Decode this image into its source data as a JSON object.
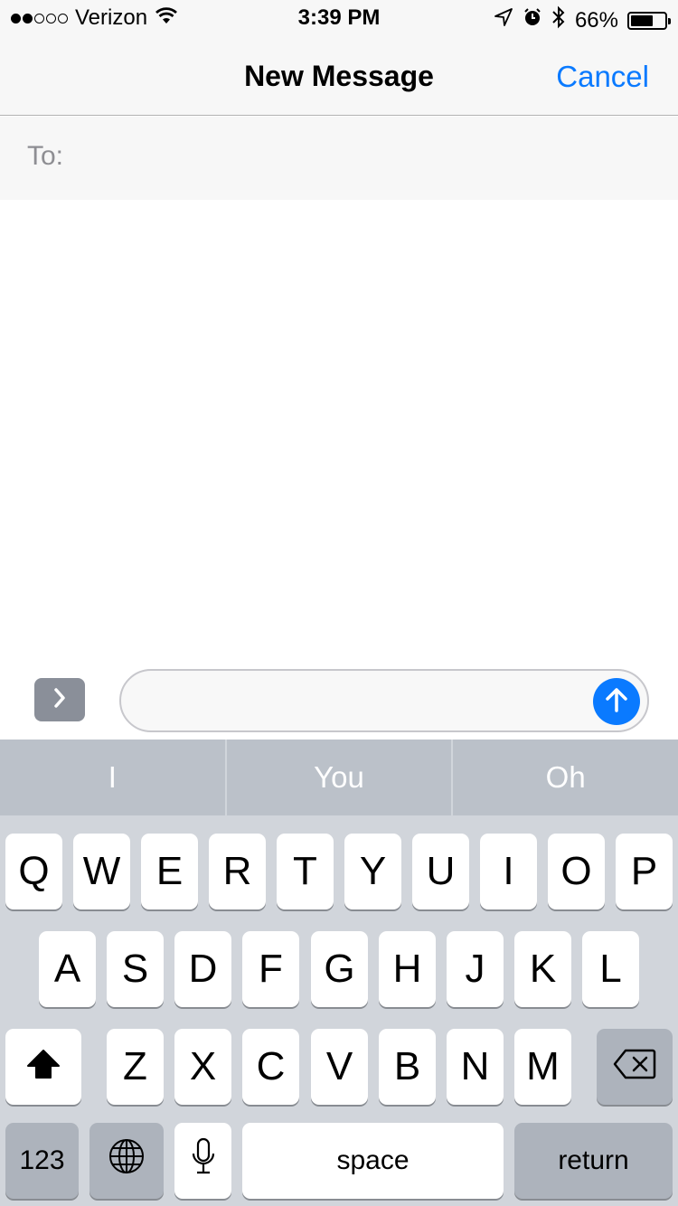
{
  "status_bar": {
    "signal_bars_filled": 2,
    "signal_bars_total": 5,
    "carrier": "Verizon",
    "time": "3:39 PM",
    "battery_percent_label": "66%",
    "battery_level": 0.66,
    "icons": [
      "wifi-icon",
      "location-icon",
      "alarm-icon",
      "bluetooth-icon",
      "battery-icon"
    ]
  },
  "nav": {
    "title": "New Message",
    "cancel_label": "Cancel"
  },
  "to_field": {
    "label": "To:",
    "value": ""
  },
  "compose": {
    "message_value": "",
    "expand_icon": "chevron-right-icon",
    "send_icon": "arrow-up-icon"
  },
  "predictive": [
    "I",
    "You",
    "Oh"
  ],
  "keyboard": {
    "row1": [
      "Q",
      "W",
      "E",
      "R",
      "T",
      "Y",
      "U",
      "I",
      "O",
      "P"
    ],
    "row2": [
      "A",
      "S",
      "D",
      "F",
      "G",
      "H",
      "J",
      "K",
      "L"
    ],
    "row3": [
      "Z",
      "X",
      "C",
      "V",
      "B",
      "N",
      "M"
    ],
    "numbers_label": "123",
    "space_label": "space",
    "return_label": "return"
  },
  "colors": {
    "accent": "#0a7aff",
    "keyboard_bg": "#d1d5db",
    "predictive_bg": "#bbc1c9"
  }
}
